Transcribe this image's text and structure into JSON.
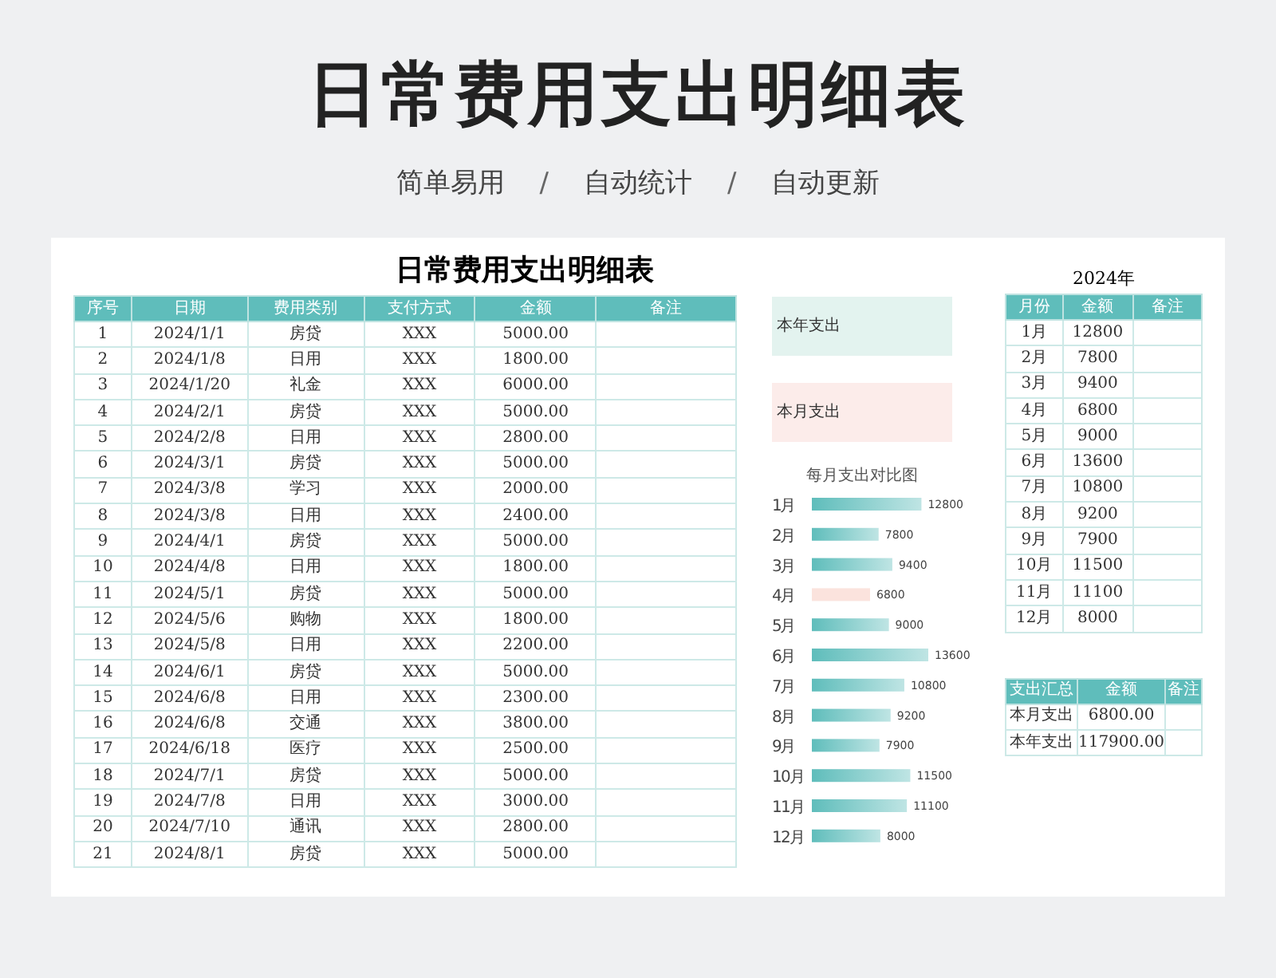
{
  "header": {
    "title": "日常费用支出明细表",
    "subtitle_parts": [
      "简单易用",
      "/",
      "自动统计",
      "/",
      "自动更新"
    ]
  },
  "sheet": {
    "title": "日常费用支出明细表",
    "columns": [
      "序号",
      "日期",
      "费用类别",
      "支付方式",
      "金额",
      "备注"
    ],
    "rows": [
      [
        "1",
        "2024/1/1",
        "房贷",
        "XXX",
        "5000.00"
      ],
      [
        "2",
        "2024/1/8",
        "日用",
        "XXX",
        "1800.00"
      ],
      [
        "3",
        "2024/1/20",
        "礼金",
        "XXX",
        "6000.00"
      ],
      [
        "4",
        "2024/2/1",
        "房贷",
        "XXX",
        "5000.00"
      ],
      [
        "5",
        "2024/2/8",
        "日用",
        "XXX",
        "2800.00"
      ],
      [
        "6",
        "2024/3/1",
        "房贷",
        "XXX",
        "5000.00"
      ],
      [
        "7",
        "2024/3/8",
        "学习",
        "XXX",
        "2000.00"
      ],
      [
        "8",
        "2024/3/8",
        "日用",
        "XXX",
        "2400.00"
      ],
      [
        "9",
        "2024/4/1",
        "房贷",
        "XXX",
        "5000.00"
      ],
      [
        "10",
        "2024/4/8",
        "日用",
        "XXX",
        "1800.00"
      ],
      [
        "11",
        "2024/5/1",
        "房贷",
        "XXX",
        "5000.00"
      ],
      [
        "12",
        "2024/5/6",
        "购物",
        "XXX",
        "1800.00"
      ],
      [
        "13",
        "2024/5/8",
        "日用",
        "XXX",
        "2200.00"
      ],
      [
        "14",
        "2024/6/1",
        "房贷",
        "XXX",
        "5000.00"
      ],
      [
        "15",
        "2024/6/8",
        "日用",
        "XXX",
        "2300.00"
      ],
      [
        "16",
        "2024/6/8",
        "交通",
        "XXX",
        "3800.00"
      ],
      [
        "17",
        "2024/6/18",
        "医疗",
        "XXX",
        "2500.00"
      ],
      [
        "18",
        "2024/7/1",
        "房贷",
        "XXX",
        "5000.00"
      ],
      [
        "19",
        "2024/7/8",
        "日用",
        "XXX",
        "3000.00"
      ],
      [
        "20",
        "2024/7/10",
        "通讯",
        "XXX",
        "2800.00"
      ],
      [
        "21",
        "2024/8/1",
        "房贷",
        "XXX",
        "5000.00"
      ]
    ]
  },
  "cards": [
    {
      "label": "本年支出",
      "kind": "year"
    },
    {
      "label": "本月支出",
      "kind": "month"
    }
  ],
  "chart": {
    "chart_data": {
      "type": "bar",
      "orientation": "horizontal",
      "title": "每月支出对比图",
      "categories": [
        "1月",
        "2月",
        "3月",
        "4月",
        "5月",
        "6月",
        "7月",
        "8月",
        "9月",
        "10月",
        "11月",
        "12月"
      ],
      "series": [
        {
          "color": "#5fbdbb",
          "values": [
            12800,
            7800,
            9400,
            null,
            9000,
            13600,
            10800,
            9200,
            7900,
            11500,
            11100,
            8000
          ]
        },
        {
          "color": "#fbe3dd",
          "values": [
            null,
            null,
            null,
            6800,
            null,
            null,
            null,
            null,
            null,
            null,
            null,
            null
          ]
        }
      ],
      "data_labels": true
    }
  },
  "monthly": {
    "year_label": "2024年",
    "columns": [
      "月份",
      "金额",
      "备注"
    ],
    "rows": [
      [
        "1月",
        "12800"
      ],
      [
        "2月",
        "7800"
      ],
      [
        "3月",
        "9400"
      ],
      [
        "4月",
        "6800"
      ],
      [
        "5月",
        "9000"
      ],
      [
        "6月",
        "13600"
      ],
      [
        "7月",
        "10800"
      ],
      [
        "8月",
        "9200"
      ],
      [
        "9月",
        "7900"
      ],
      [
        "10月",
        "11500"
      ],
      [
        "11月",
        "11100"
      ],
      [
        "12月",
        "8000"
      ]
    ]
  },
  "summary": {
    "columns": [
      "支出汇总",
      "金额",
      "备注"
    ],
    "rows": [
      [
        "本月支出",
        "6800.00"
      ],
      [
        "本年支出",
        "117900.00"
      ]
    ]
  }
}
